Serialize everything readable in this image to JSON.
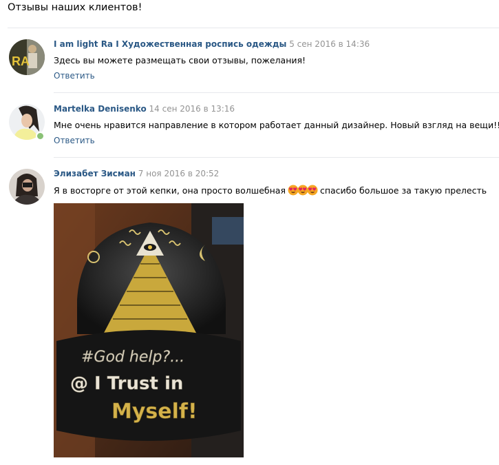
{
  "page": {
    "title": "Отзывы наших клиентов!"
  },
  "comments": [
    {
      "author": "I am light Ra I Художественная роспись одежды",
      "date": "5 сен 2016 в 14:36",
      "text": "Здесь вы можете размещать свои отзывы, пожелания!",
      "reply_label": "Ответить",
      "avatar_text": "RA"
    },
    {
      "author": "Martelka Denisenko",
      "date": "14 сен 2016 в 13:16",
      "text": "Мне очень нравится направление в котором работает данный дизайнер. Новый взгляд на вещи!!!",
      "reply_label": "Ответить",
      "online": true
    },
    {
      "author": "Элизабет Зисман",
      "date": "7 ноя 2016 в 20:52",
      "text_before": "Я в восторге от этой кепки, она просто волшебная",
      "emojis": [
        "heart-eyes-icon",
        "heart-eyes-icon",
        "heart-eyes-icon"
      ],
      "text_after": "спасибо большое за такую прелесть",
      "photo": {
        "subject": "hand-painted cap",
        "line1": "#God help?...",
        "line2": "@ I Trust in",
        "line3": "Myself!"
      }
    }
  ],
  "colors": {
    "link": "#2a5885",
    "date": "#939393",
    "divider": "#e7e8ec",
    "online": "#8ac176",
    "paint_gold": "#d4b24a"
  }
}
